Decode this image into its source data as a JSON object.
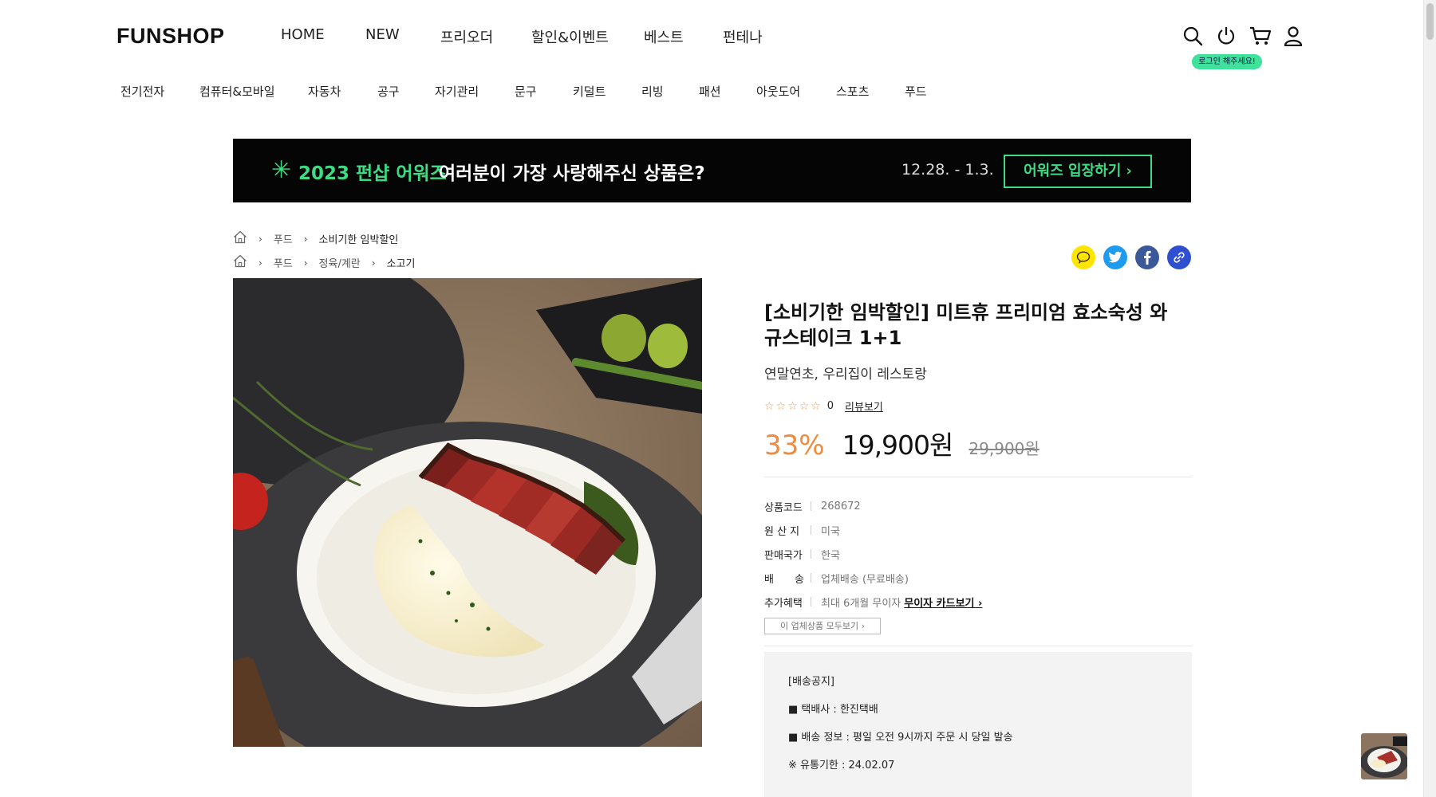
{
  "header": {
    "logo": "FUNSHOP",
    "nav": [
      "HOME",
      "NEW",
      "프리오더",
      "할인&이벤트",
      "베스트",
      "펀테나"
    ],
    "icons": [
      "search-icon",
      "power-icon",
      "cart-icon",
      "user-icon"
    ],
    "login_tip": "로그인 해주세요!"
  },
  "categories": [
    "전기전자",
    "컴퓨터&모바일",
    "자동차",
    "공구",
    "자기관리",
    "문구",
    "키덜트",
    "리빙",
    "패션",
    "아웃도어",
    "스포츠",
    "푸드"
  ],
  "banner": {
    "star": "✳",
    "title": "2023 펀샵 어워즈",
    "subtitle": "여러분이 가장 사랑해주신 상품은?",
    "date": "12.28. - 1.3.",
    "button": "어워즈 입장하기 ›"
  },
  "breadcrumbs": [
    [
      "푸드",
      "소비기한 임박할인"
    ],
    [
      "푸드",
      "정육/계란",
      "소고기"
    ]
  ],
  "share_icons": [
    "kakao-icon",
    "twitter-icon",
    "facebook-icon",
    "link-icon"
  ],
  "product": {
    "title": "[소비기한 임박할인] 미트휴 프리미엄 효소숙성 와규스테이크 1+1",
    "subtitle": "연말연초, 우리집이 레스토랑",
    "stars": "☆☆☆☆☆",
    "rating_count": "0",
    "review_link": "리뷰보기",
    "discount": "33%",
    "price": "19,900원",
    "original_price": "29,900원",
    "specs": [
      {
        "label": "상품코드",
        "value": "268672"
      },
      {
        "label": "원 산 지",
        "value": "미국"
      },
      {
        "label": "판매국가",
        "value": "한국"
      },
      {
        "label": "배　　송",
        "value": "업체배송 (무료배송)"
      },
      {
        "label": "추가혜택",
        "value": "최대 6개월 무이자",
        "link": "무이자 카드보기 ›"
      }
    ],
    "all_products_button": "이 업체상품 모두보기 ›",
    "notice": [
      "[배송공지]",
      "■ 택배사 : 한진택배",
      "■ 배송 정보 : 평일 오전 9시까지 주문 시 당일 발송",
      "※ 유통기한 : 24.02.07"
    ]
  },
  "colors": {
    "accent_orange": "#f08a3c",
    "banner_green": "#3ddc84",
    "login_tip_green": "#3ee29a"
  }
}
